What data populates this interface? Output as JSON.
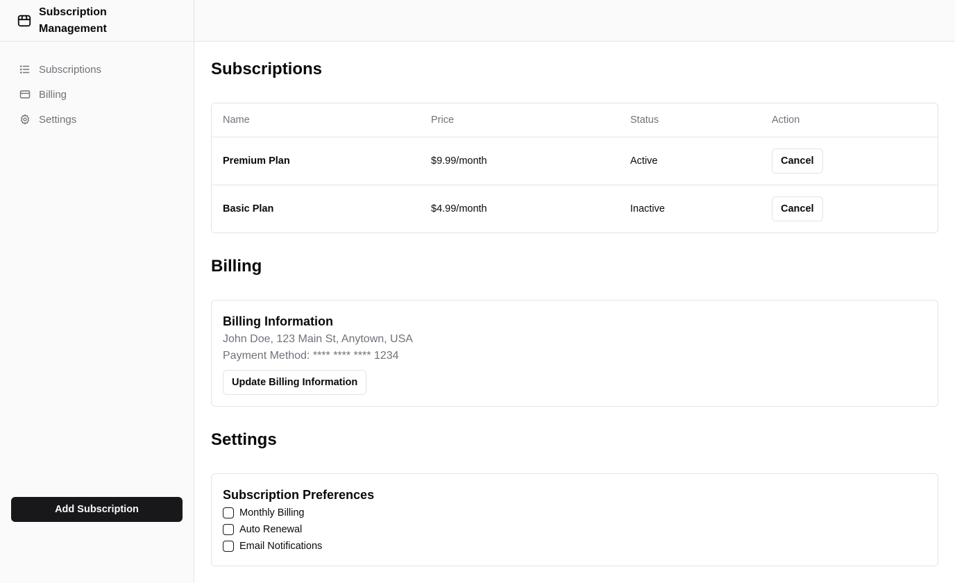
{
  "app": {
    "title": "Subscription Management",
    "logo_icon": "package-icon"
  },
  "sidebar": {
    "items": [
      {
        "label": "Subscriptions",
        "icon": "list-icon"
      },
      {
        "label": "Billing",
        "icon": "credit-card-icon"
      },
      {
        "label": "Settings",
        "icon": "gear-icon"
      }
    ],
    "add_button": "Add Subscription"
  },
  "subscriptions": {
    "title": "Subscriptions",
    "columns": [
      "Name",
      "Price",
      "Status",
      "Action"
    ],
    "rows": [
      {
        "name": "Premium Plan",
        "price": "$9.99/month",
        "status": "Active",
        "action": "Cancel"
      },
      {
        "name": "Basic Plan",
        "price": "$4.99/month",
        "status": "Inactive",
        "action": "Cancel"
      }
    ]
  },
  "billing": {
    "title": "Billing",
    "card_title": "Billing Information",
    "address": "John Doe, 123 Main St, Anytown, USA",
    "payment": "Payment Method: **** **** **** 1234",
    "update_button": "Update Billing Information"
  },
  "settings": {
    "title": "Settings",
    "card_title": "Subscription Preferences",
    "options": [
      {
        "label": "Monthly Billing",
        "checked": false
      },
      {
        "label": "Auto Renewal",
        "checked": false
      },
      {
        "label": "Email Notifications",
        "checked": false
      }
    ]
  },
  "colors": {
    "primary": "#18181b",
    "muted": "#71717a",
    "border": "#e4e4e7",
    "sidebar_bg": "#fafafa"
  }
}
